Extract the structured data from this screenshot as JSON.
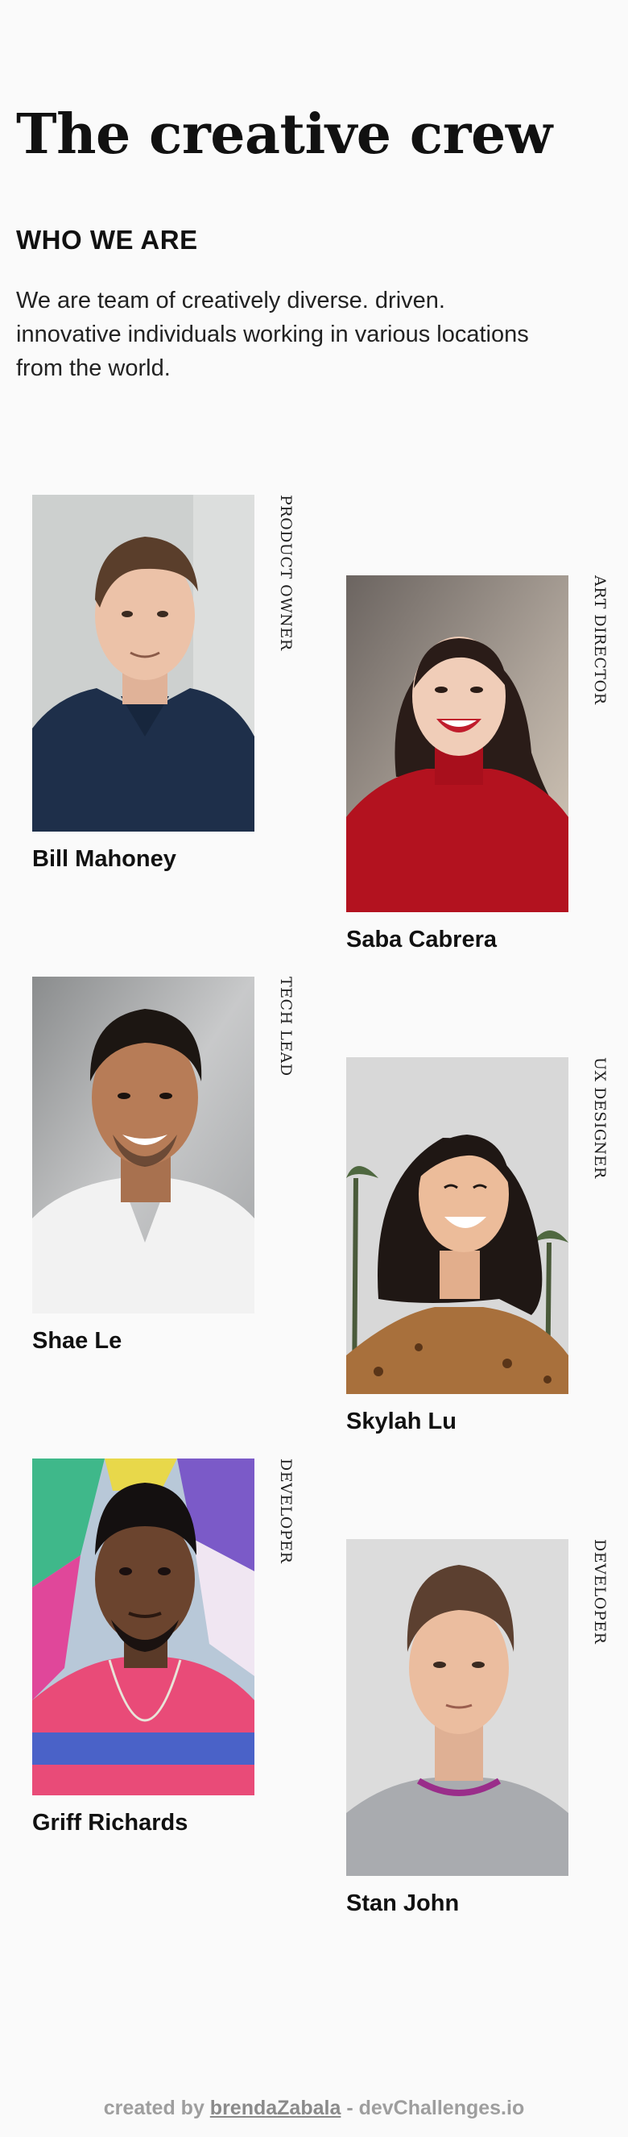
{
  "header": {
    "title": "The creative crew",
    "subtitle": "WHO WE ARE",
    "description": "We are team of creatively diverse. driven. innovative individuals working in various locations from the world."
  },
  "members": [
    {
      "name": "Bill Mahoney",
      "role": "PRODUCT OWNER"
    },
    {
      "name": "Saba Cabrera",
      "role": "ART DIRECTOR"
    },
    {
      "name": "Shae Le",
      "role": "TECH LEAD"
    },
    {
      "name": "Skylah Lu",
      "role": "UX DESIGNER"
    },
    {
      "name": "Griff Richards",
      "role": "DEVELOPER"
    },
    {
      "name": "Stan John",
      "role": "DEVELOPER"
    }
  ],
  "footer": {
    "prefix": "created by",
    "author": "brendaZabala",
    "separator": "-",
    "site": "devChallenges.io"
  }
}
